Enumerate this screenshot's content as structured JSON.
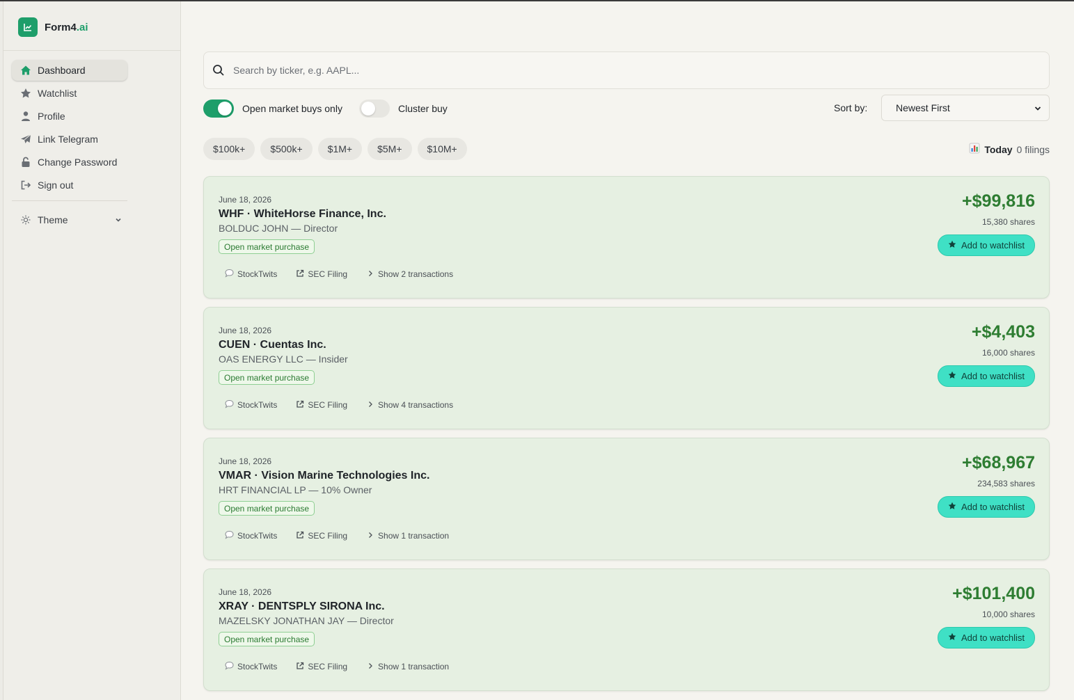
{
  "brand": {
    "name": "Form4",
    "suffix": ".ai"
  },
  "sidebar": {
    "items": [
      {
        "label": "Dashboard",
        "icon": "home-icon",
        "active": true
      },
      {
        "label": "Watchlist",
        "icon": "star-icon"
      },
      {
        "label": "Profile",
        "icon": "user-icon"
      },
      {
        "label": "Link Telegram",
        "icon": "telegram-icon"
      },
      {
        "label": "Change Password",
        "icon": "lock-icon"
      },
      {
        "label": "Sign out",
        "icon": "sign-out-icon"
      }
    ],
    "theme_label": "Theme"
  },
  "search": {
    "placeholder": "Search by ticker, e.g. AAPL...",
    "value": ""
  },
  "filters": {
    "open_market_label": "Open market buys only",
    "open_market_on": true,
    "cluster_label": "Cluster buy",
    "cluster_on": false,
    "sort_label": "Sort by:",
    "sort_value": "Newest First"
  },
  "chips": [
    "$100k+",
    "$500k+",
    "$1M+",
    "$5M+",
    "$10M+"
  ],
  "today": {
    "icon": "bar-chart-icon",
    "label": "Today",
    "count": "0 filings"
  },
  "common": {
    "stocktwits": "StockTwits",
    "sec_filing": "SEC Filing",
    "watch_label": "Add to watchlist"
  },
  "cards": [
    {
      "date": "June 18, 2026",
      "title": "WHF · WhiteHorse Finance, Inc.",
      "owner": "BOLDUC JOHN — Director",
      "badge": "Open market purchase",
      "transactions": "Show 2 transactions",
      "amount": "+$99,816",
      "shares": "15,380 shares"
    },
    {
      "date": "June 18, 2026",
      "title": "CUEN · Cuentas Inc.",
      "owner": "OAS ENERGY LLC — Insider",
      "badge": "Open market purchase",
      "transactions": "Show 4 transactions",
      "amount": "+$4,403",
      "shares": "16,000 shares"
    },
    {
      "date": "June 18, 2026",
      "title": "VMAR · Vision Marine Technologies Inc.",
      "owner": "HRT FINANCIAL LP — 10% Owner",
      "badge": "Open market purchase",
      "transactions": "Show 1 transaction",
      "amount": "+$68,967",
      "shares": "234,583 shares"
    },
    {
      "date": "June 18, 2026",
      "title": "XRAY · DENTSPLY SIRONA Inc.",
      "owner": "MAZELSKY JONATHAN JAY — Director",
      "badge": "Open market purchase",
      "transactions": "Show 1 transaction",
      "amount": "+$101,400",
      "shares": "10,000 shares"
    }
  ]
}
